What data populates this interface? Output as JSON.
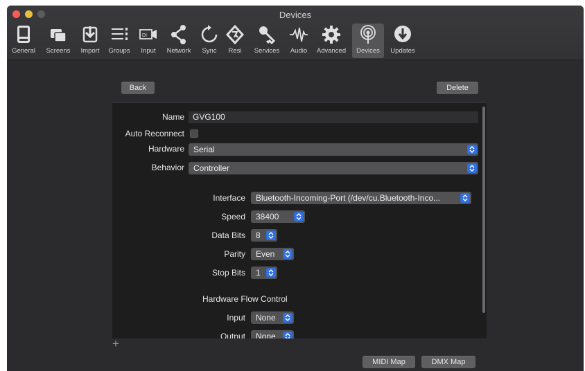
{
  "window": {
    "title": "Devices"
  },
  "toolbar": {
    "items": [
      {
        "label": "General",
        "icon": "general-icon"
      },
      {
        "label": "Screens",
        "icon": "screens-icon"
      },
      {
        "label": "Import",
        "icon": "import-icon"
      },
      {
        "label": "Groups",
        "icon": "groups-icon"
      },
      {
        "label": "Input",
        "icon": "input-icon"
      },
      {
        "label": "Network",
        "icon": "network-icon"
      },
      {
        "label": "Sync",
        "icon": "sync-icon"
      },
      {
        "label": "Resi",
        "icon": "resi-icon"
      },
      {
        "label": "Services",
        "icon": "services-icon"
      },
      {
        "label": "Audio",
        "icon": "audio-icon"
      },
      {
        "label": "Advanced",
        "icon": "advanced-icon"
      },
      {
        "label": "Devices",
        "icon": "devices-icon",
        "active": true
      },
      {
        "label": "Updates",
        "icon": "updates-icon"
      }
    ]
  },
  "nav": {
    "back_label": "Back",
    "delete_label": "Delete"
  },
  "device": {
    "name_label": "Name",
    "name_value": "GVG100",
    "auto_reconnect_label": "Auto Reconnect",
    "hardware_label": "Hardware",
    "hardware_value": "Serial",
    "behavior_label": "Behavior",
    "behavior_value": "Controller"
  },
  "serial": {
    "interface_label": "Interface",
    "interface_value": "Bluetooth-Incoming-Port (/dev/cu.Bluetooth-Inco...",
    "speed_label": "Speed",
    "speed_value": "38400",
    "data_bits_label": "Data Bits",
    "data_bits_value": "8",
    "parity_label": "Parity",
    "parity_value": "Even",
    "stop_bits_label": "Stop Bits",
    "stop_bits_value": "1",
    "hw_flow_label": "Hardware Flow Control",
    "input_label": "Input",
    "input_value": "None",
    "output_label": "Output",
    "output_value": "None"
  },
  "footer": {
    "add_label": "+",
    "midi_map_label": "MIDI Map",
    "dmx_map_label": "DMX Map"
  },
  "colors": {
    "accent": "#2f6fe0",
    "background": "#2b2b2d",
    "panel": "#1d1d1e"
  }
}
